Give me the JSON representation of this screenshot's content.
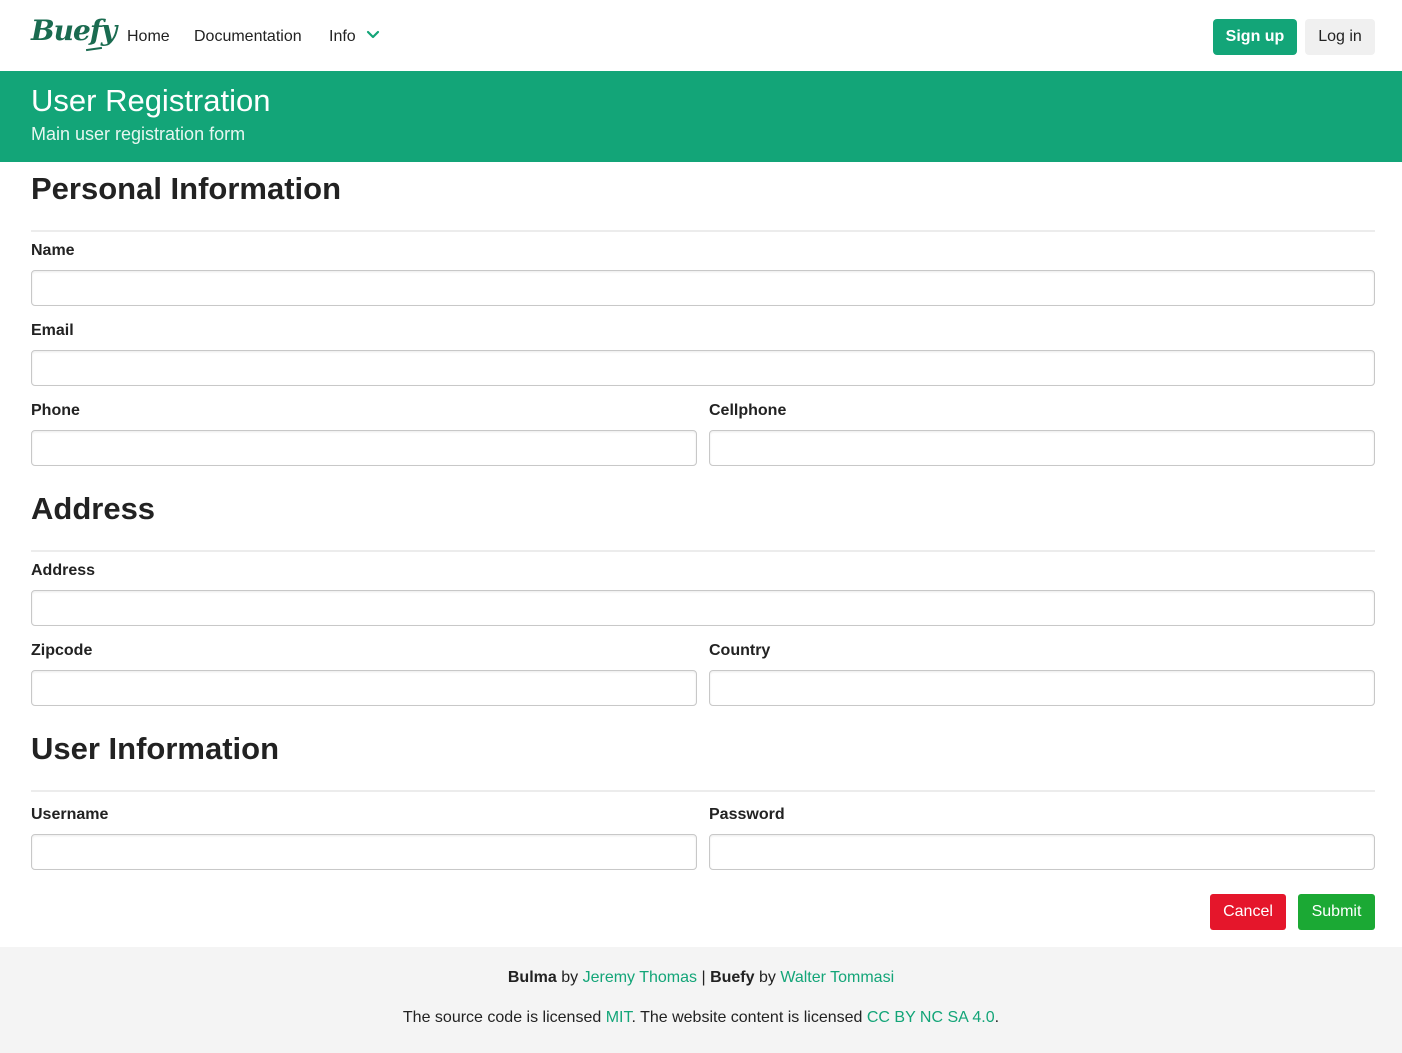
{
  "navbar": {
    "logo": "Buefy",
    "items": [
      {
        "label": "Home"
      },
      {
        "label": "Documentation"
      },
      {
        "label": "Info"
      }
    ],
    "signup_label": "Sign up",
    "login_label": "Log in"
  },
  "hero": {
    "title": "User Registration",
    "subtitle": "Main user registration form"
  },
  "form": {
    "sections": [
      {
        "title": "Personal Information"
      },
      {
        "title": "Address"
      },
      {
        "title": "User Information"
      }
    ],
    "fields": {
      "name": {
        "label": "Name",
        "value": ""
      },
      "email": {
        "label": "Email",
        "value": ""
      },
      "phone": {
        "label": "Phone",
        "value": ""
      },
      "cellphone": {
        "label": "Cellphone",
        "value": ""
      },
      "address": {
        "label": "Address",
        "value": ""
      },
      "zipcode": {
        "label": "Zipcode",
        "value": ""
      },
      "country": {
        "label": "Country",
        "value": ""
      },
      "username": {
        "label": "Username",
        "value": ""
      },
      "password": {
        "label": "Password",
        "value": ""
      }
    },
    "cancel_label": "Cancel",
    "submit_label": "Submit"
  },
  "footer": {
    "bulma": "Bulma",
    "by1": "by",
    "author1": "Jeremy Thomas",
    "sep": "|",
    "buefy": "Buefy",
    "by2": "by",
    "author2": "Walter Tommasi",
    "license_prefix": "The source code is licensed",
    "license_code": "MIT",
    "license_mid": ". The website content is licensed",
    "license_content": "CC BY NC SA 4.0",
    "license_suffix": "."
  },
  "colors": {
    "primary": "#13a578",
    "danger": "#e5162b",
    "success": "#1ba934"
  }
}
